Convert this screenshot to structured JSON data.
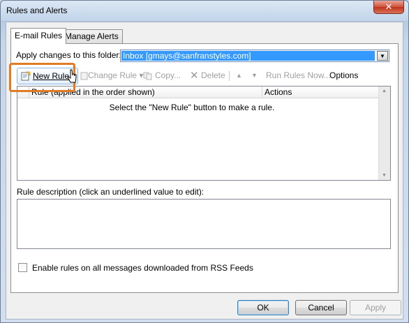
{
  "window": {
    "title": "Rules and Alerts",
    "close_label": "✕"
  },
  "tabs": [
    {
      "label": "E-mail Rules",
      "selected": true
    },
    {
      "label": "Manage Alerts",
      "selected": false
    }
  ],
  "folder": {
    "label": "Apply changes to this folder:",
    "value": "Inbox [gmays@sanfranstyles.com]"
  },
  "toolbar": {
    "new_rule": "New Rule...",
    "change_rule": "Change Rule",
    "copy": "Copy...",
    "delete": "Delete",
    "run_rules_now": "Run Rules Now...",
    "options": "Options"
  },
  "rules_table": {
    "columns": [
      "Rule (applied in the order shown)",
      "Actions"
    ],
    "empty_message": "Select the \"New Rule\" button to make a rule."
  },
  "description": {
    "label": "Rule description (click an underlined value to edit):"
  },
  "rss": {
    "label": "Enable rules on all messages downloaded from RSS Feeds",
    "checked": false
  },
  "buttons": {
    "ok": "OK",
    "cancel": "Cancel",
    "apply": "Apply"
  },
  "colors": {
    "highlight": "#e07b26",
    "selection": "#3399ff"
  }
}
